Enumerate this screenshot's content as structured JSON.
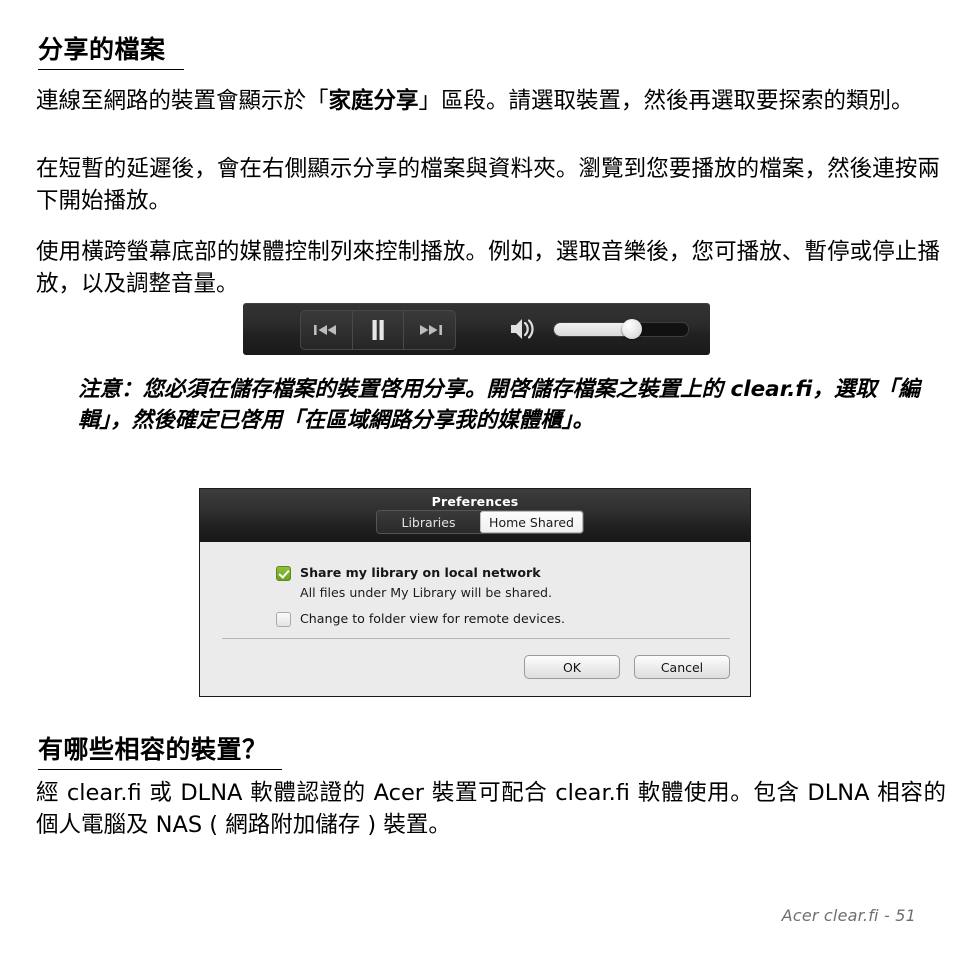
{
  "document": {
    "heading_1": "分享的檔案",
    "heading_2": "有哪些相容的裝置？",
    "para_1_a": "連線至網路的裝置會顯示於「",
    "para_1_b": "家庭分享",
    "para_1_c": "」區段。請選取裝置，然後再選取要探索的類別。",
    "para_2": "在短暫的延遲後，會在右側顯示分享的檔案與資料夾。瀏覽到您要播放的檔案，然後連按兩下開始播放。",
    "para_3": "使用橫跨螢幕底部的媒體控制列來控制播放。例如，選取音樂後，您可播放、暫停或停止播放，以及調整音量。",
    "note": "注意：您必須在儲存檔案的裝置啓用分享。開啓儲存檔案之裝置上的 clear.fi，選取「編輯」，然後確定已啓用「在區域網路分享我的媒體櫃」。",
    "para_4": "經 clear.fi 或 DLNA 軟體認證的 Acer 裝置可配合 clear.fi 軟體使用。包含 DLNA 相容的個人電腦及 NAS ( 網路附加儲存 ) 裝置。",
    "footer": "Acer clear.fi -  51"
  },
  "media_bar": {
    "previous_icon": "previous-track-icon",
    "pause_icon": "pause-icon",
    "next_icon": "next-track-icon",
    "volume_icon": "speaker-volume-icon",
    "volume_percent": 58,
    "background_color": "#262626"
  },
  "dialog": {
    "title": "Preferences",
    "tabs": [
      {
        "label": "Libraries",
        "active": false
      },
      {
        "label": "Home Shared",
        "active": true
      }
    ],
    "options": [
      {
        "label": "Share my library on local network",
        "checked": true,
        "sub_label": "All files under My Library will be shared."
      },
      {
        "label": "Change to folder view for remote devices.",
        "checked": false
      }
    ],
    "buttons": [
      {
        "label": "OK"
      },
      {
        "label": "Cancel"
      }
    ],
    "accent_color": "#7bb02e",
    "titlebar_color": "#252525",
    "body_color": "#ebebeb"
  }
}
